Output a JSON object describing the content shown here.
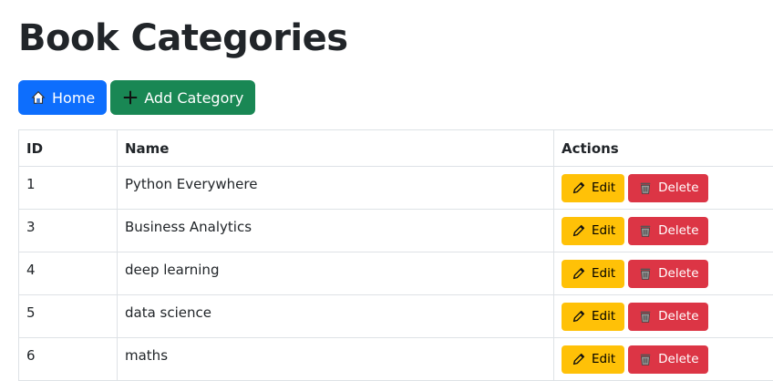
{
  "page": {
    "title": "Book Categories"
  },
  "toolbar": {
    "home_label": "Home",
    "add_label": "Add Category"
  },
  "table": {
    "headers": {
      "id": "ID",
      "name": "Name",
      "actions": "Actions"
    },
    "rows": [
      {
        "id": "1",
        "name": "Python Everywhere"
      },
      {
        "id": "3",
        "name": "Business Analytics"
      },
      {
        "id": "4",
        "name": "deep learning"
      },
      {
        "id": "5",
        "name": "data science"
      },
      {
        "id": "6",
        "name": "maths"
      }
    ],
    "edit_label": "Edit",
    "delete_label": "Delete"
  },
  "icons": {
    "home": "house-icon",
    "add": "plus-icon",
    "edit": "pencil-icon",
    "delete": "trash-icon"
  },
  "colors": {
    "primary": "#0d6efd",
    "success": "#198754",
    "warning": "#ffc107",
    "danger": "#dc3545"
  }
}
